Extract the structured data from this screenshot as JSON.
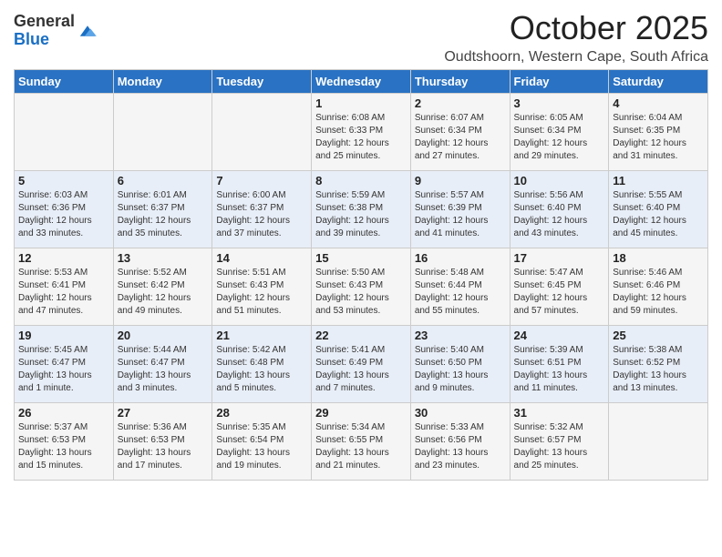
{
  "header": {
    "logo_general": "General",
    "logo_blue": "Blue",
    "month_title": "October 2025",
    "location": "Oudtshoorn, Western Cape, South Africa"
  },
  "days_of_week": [
    "Sunday",
    "Monday",
    "Tuesday",
    "Wednesday",
    "Thursday",
    "Friday",
    "Saturday"
  ],
  "weeks": [
    [
      {
        "day": "",
        "info": ""
      },
      {
        "day": "",
        "info": ""
      },
      {
        "day": "",
        "info": ""
      },
      {
        "day": "1",
        "info": "Sunrise: 6:08 AM\nSunset: 6:33 PM\nDaylight: 12 hours\nand 25 minutes."
      },
      {
        "day": "2",
        "info": "Sunrise: 6:07 AM\nSunset: 6:34 PM\nDaylight: 12 hours\nand 27 minutes."
      },
      {
        "day": "3",
        "info": "Sunrise: 6:05 AM\nSunset: 6:34 PM\nDaylight: 12 hours\nand 29 minutes."
      },
      {
        "day": "4",
        "info": "Sunrise: 6:04 AM\nSunset: 6:35 PM\nDaylight: 12 hours\nand 31 minutes."
      }
    ],
    [
      {
        "day": "5",
        "info": "Sunrise: 6:03 AM\nSunset: 6:36 PM\nDaylight: 12 hours\nand 33 minutes."
      },
      {
        "day": "6",
        "info": "Sunrise: 6:01 AM\nSunset: 6:37 PM\nDaylight: 12 hours\nand 35 minutes."
      },
      {
        "day": "7",
        "info": "Sunrise: 6:00 AM\nSunset: 6:37 PM\nDaylight: 12 hours\nand 37 minutes."
      },
      {
        "day": "8",
        "info": "Sunrise: 5:59 AM\nSunset: 6:38 PM\nDaylight: 12 hours\nand 39 minutes."
      },
      {
        "day": "9",
        "info": "Sunrise: 5:57 AM\nSunset: 6:39 PM\nDaylight: 12 hours\nand 41 minutes."
      },
      {
        "day": "10",
        "info": "Sunrise: 5:56 AM\nSunset: 6:40 PM\nDaylight: 12 hours\nand 43 minutes."
      },
      {
        "day": "11",
        "info": "Sunrise: 5:55 AM\nSunset: 6:40 PM\nDaylight: 12 hours\nand 45 minutes."
      }
    ],
    [
      {
        "day": "12",
        "info": "Sunrise: 5:53 AM\nSunset: 6:41 PM\nDaylight: 12 hours\nand 47 minutes."
      },
      {
        "day": "13",
        "info": "Sunrise: 5:52 AM\nSunset: 6:42 PM\nDaylight: 12 hours\nand 49 minutes."
      },
      {
        "day": "14",
        "info": "Sunrise: 5:51 AM\nSunset: 6:43 PM\nDaylight: 12 hours\nand 51 minutes."
      },
      {
        "day": "15",
        "info": "Sunrise: 5:50 AM\nSunset: 6:43 PM\nDaylight: 12 hours\nand 53 minutes."
      },
      {
        "day": "16",
        "info": "Sunrise: 5:48 AM\nSunset: 6:44 PM\nDaylight: 12 hours\nand 55 minutes."
      },
      {
        "day": "17",
        "info": "Sunrise: 5:47 AM\nSunset: 6:45 PM\nDaylight: 12 hours\nand 57 minutes."
      },
      {
        "day": "18",
        "info": "Sunrise: 5:46 AM\nSunset: 6:46 PM\nDaylight: 12 hours\nand 59 minutes."
      }
    ],
    [
      {
        "day": "19",
        "info": "Sunrise: 5:45 AM\nSunset: 6:47 PM\nDaylight: 13 hours\nand 1 minute."
      },
      {
        "day": "20",
        "info": "Sunrise: 5:44 AM\nSunset: 6:47 PM\nDaylight: 13 hours\nand 3 minutes."
      },
      {
        "day": "21",
        "info": "Sunrise: 5:42 AM\nSunset: 6:48 PM\nDaylight: 13 hours\nand 5 minutes."
      },
      {
        "day": "22",
        "info": "Sunrise: 5:41 AM\nSunset: 6:49 PM\nDaylight: 13 hours\nand 7 minutes."
      },
      {
        "day": "23",
        "info": "Sunrise: 5:40 AM\nSunset: 6:50 PM\nDaylight: 13 hours\nand 9 minutes."
      },
      {
        "day": "24",
        "info": "Sunrise: 5:39 AM\nSunset: 6:51 PM\nDaylight: 13 hours\nand 11 minutes."
      },
      {
        "day": "25",
        "info": "Sunrise: 5:38 AM\nSunset: 6:52 PM\nDaylight: 13 hours\nand 13 minutes."
      }
    ],
    [
      {
        "day": "26",
        "info": "Sunrise: 5:37 AM\nSunset: 6:53 PM\nDaylight: 13 hours\nand 15 minutes."
      },
      {
        "day": "27",
        "info": "Sunrise: 5:36 AM\nSunset: 6:53 PM\nDaylight: 13 hours\nand 17 minutes."
      },
      {
        "day": "28",
        "info": "Sunrise: 5:35 AM\nSunset: 6:54 PM\nDaylight: 13 hours\nand 19 minutes."
      },
      {
        "day": "29",
        "info": "Sunrise: 5:34 AM\nSunset: 6:55 PM\nDaylight: 13 hours\nand 21 minutes."
      },
      {
        "day": "30",
        "info": "Sunrise: 5:33 AM\nSunset: 6:56 PM\nDaylight: 13 hours\nand 23 minutes."
      },
      {
        "day": "31",
        "info": "Sunrise: 5:32 AM\nSunset: 6:57 PM\nDaylight: 13 hours\nand 25 minutes."
      },
      {
        "day": "",
        "info": ""
      }
    ]
  ]
}
